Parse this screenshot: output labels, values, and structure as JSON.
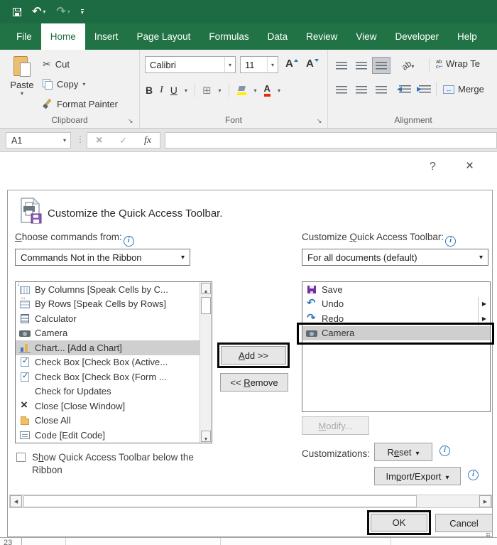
{
  "ribbon_tabs": [
    {
      "label": "File"
    },
    {
      "label": "Home",
      "active": true
    },
    {
      "label": "Insert"
    },
    {
      "label": "Page Layout"
    },
    {
      "label": "Formulas"
    },
    {
      "label": "Data"
    },
    {
      "label": "Review"
    },
    {
      "label": "View"
    },
    {
      "label": "Developer"
    },
    {
      "label": "Help"
    }
  ],
  "ribbon": {
    "clipboard": {
      "group_label": "Clipboard",
      "paste_label": "Paste",
      "cut_label": "Cut",
      "copy_label": "Copy",
      "format_painter_label": "Format Painter"
    },
    "font": {
      "group_label": "Font",
      "name_value": "Calibri",
      "size_value": "11",
      "grow_label": "A",
      "shrink_label": "A",
      "bold_label": "B",
      "italic_label": "I",
      "underline_label": "U",
      "font_color_label": "A"
    },
    "alignment": {
      "group_label": "Alignment",
      "orientation_text": "ab",
      "wrap_icon_top": "ab",
      "wrap_icon_bottom": "c",
      "wrap_label": "Wrap Te",
      "merge_label": "Merge"
    }
  },
  "formula_bar": {
    "name_box_value": "A1",
    "fx_label": "fx"
  },
  "options_window": {
    "help_glyph": "?",
    "close_glyph": "×"
  },
  "dialog": {
    "title": "Customize the Quick Access Toolbar.",
    "choose_commands_label": {
      "pre": "",
      "accel": "C",
      "post": "hoose commands from:"
    },
    "choose_commands_value": "Commands Not in the Ribbon",
    "customize_label": {
      "pre": "Customize ",
      "accel": "Q",
      "post": "uick Access Toolbar:"
    },
    "customize_value": "For all documents (default)",
    "commands_list": [
      {
        "icon": "by-columns",
        "label": "By Columns [Speak Cells by C..."
      },
      {
        "icon": "by-rows",
        "label": "By Rows [Speak Cells by Rows]"
      },
      {
        "icon": "calculator",
        "label": "Calculator"
      },
      {
        "icon": "camera",
        "label": "Camera"
      },
      {
        "icon": "chart",
        "label": "Chart... [Add a Chart]",
        "selected": true
      },
      {
        "icon": "checkbox",
        "label": "Check Box [Check Box (Active..."
      },
      {
        "icon": "checkbox",
        "label": "Check Box [Check Box (Form ..."
      },
      {
        "label": "Check for Updates"
      },
      {
        "icon": "close",
        "label": "Close [Close Window]"
      },
      {
        "icon": "close-all",
        "label": "Close All"
      },
      {
        "icon": "code",
        "label": "Code [Edit Code]"
      }
    ],
    "qat_list": [
      {
        "icon": "save-purple",
        "label": "Save"
      },
      {
        "icon": "undo-blue",
        "label": "Undo",
        "flyout": true
      },
      {
        "icon": "redo-blue",
        "label": "Redo",
        "flyout": true
      },
      {
        "icon": "camera",
        "label": "Camera",
        "selected": true,
        "highlighted": true
      }
    ],
    "add_button": {
      "pre": "",
      "accel": "A",
      "post": "dd >>"
    },
    "remove_button": {
      "pre": "<< ",
      "accel": "R",
      "post": "emove"
    },
    "modify_button": {
      "pre": "",
      "accel": "M",
      "post": "odify..."
    },
    "customizations_label": "Customizations:",
    "reset_button": {
      "pre": "R",
      "accel": "e",
      "post": "set"
    },
    "import_export_button": {
      "pre": "Im",
      "accel": "p",
      "post": "ort/Export"
    },
    "show_qat_checkbox": {
      "pre": "S",
      "accel": "h",
      "post": "ow Quick Access Toolbar below the Ribbon"
    },
    "ok_button": "OK",
    "cancel_button": "Cancel"
  },
  "worksheet": {
    "row_header": "23"
  }
}
